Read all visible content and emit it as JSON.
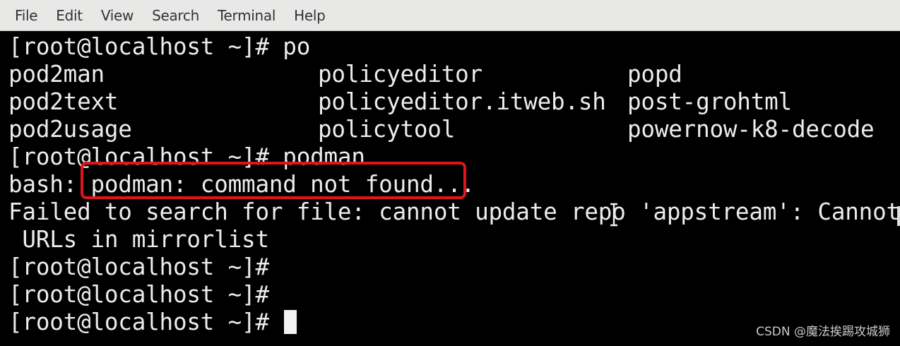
{
  "menubar": {
    "items": [
      "File",
      "Edit",
      "View",
      "Search",
      "Terminal",
      "Help"
    ]
  },
  "terminal": {
    "prompt_1": "[root@localhost ~]# po",
    "completions": [
      [
        "pod2man",
        "policyeditor",
        "popd"
      ],
      [
        "pod2text",
        "policyeditor.itweb.sh",
        "post-grohtml"
      ],
      [
        "pod2usage",
        "policytool",
        "powernow-k8-decode"
      ]
    ],
    "prompt_2": "[root@localhost ~]# podman",
    "error_prefix": "bash: ",
    "error_message": "podman: command not found...",
    "failed_line": "Failed to search for file: cannot update repo 'appstream': Cannot",
    "failed_line_cont": " URLs in mirrorlist",
    "prompt_3": "[root@localhost ~]#",
    "prompt_4": "[root@localhost ~]#",
    "prompt_5": "[root@localhost ~]# "
  },
  "annotation": {
    "highlight_color": "#e0151b"
  },
  "watermark": "CSDN @魔法挨踢攻城狮",
  "icons": {
    "text_cursor": "ibeam-cursor-icon"
  }
}
